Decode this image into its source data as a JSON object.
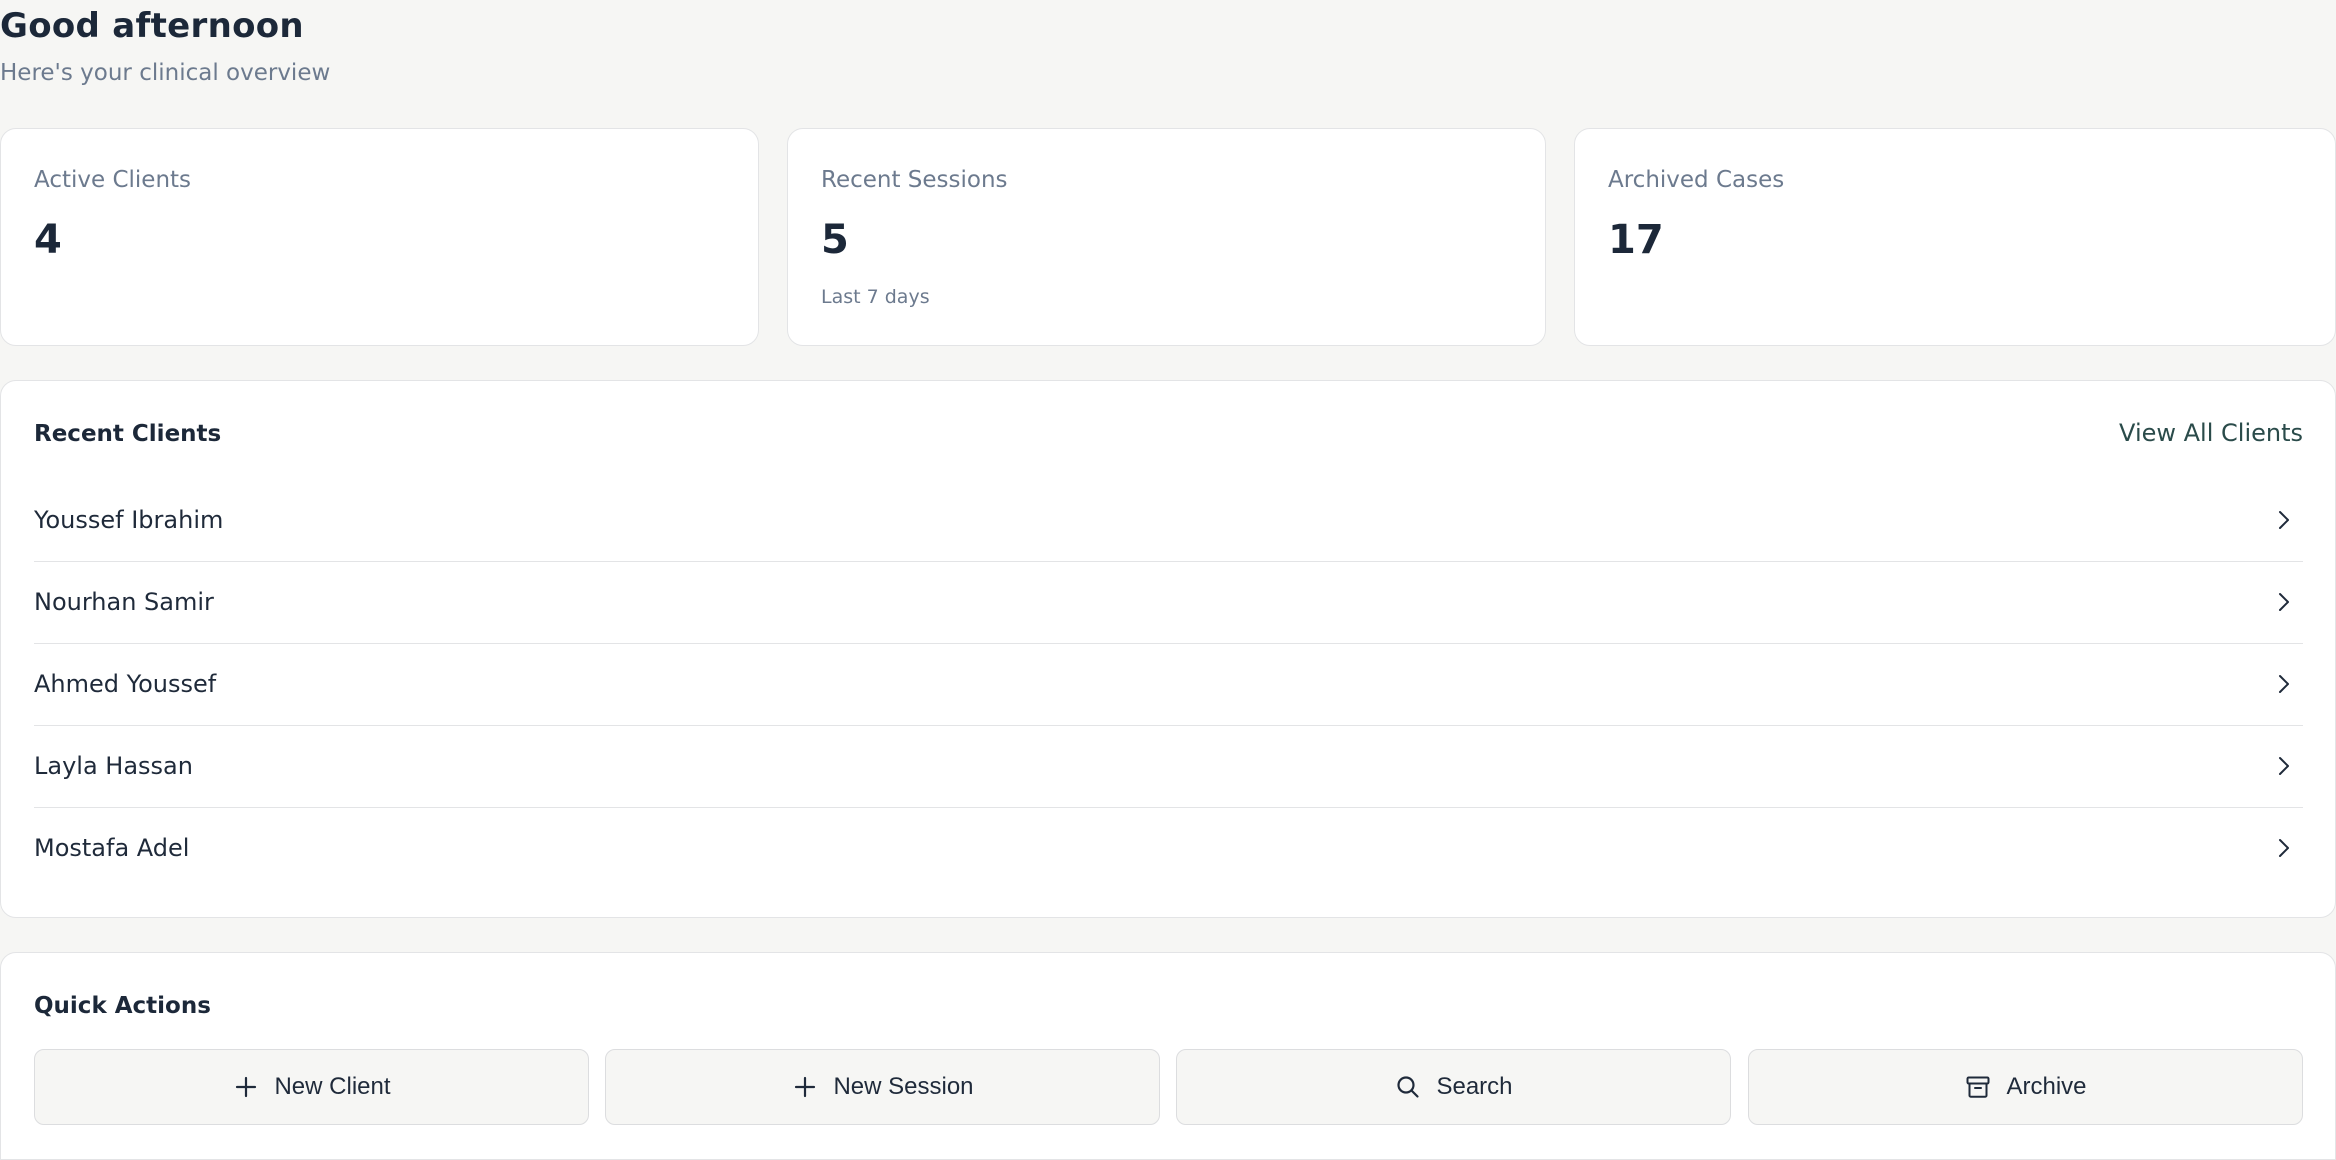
{
  "header": {
    "greeting": "Good afternoon",
    "subtitle": "Here's your clinical overview"
  },
  "stats": [
    {
      "label": "Active Clients",
      "value": "4",
      "note": ""
    },
    {
      "label": "Recent Sessions",
      "value": "5",
      "note": "Last 7 days"
    },
    {
      "label": "Archived Cases",
      "value": "17",
      "note": ""
    }
  ],
  "recent_clients": {
    "title": "Recent Clients",
    "view_all_label": "View All Clients",
    "items": [
      {
        "name": "Youssef Ibrahim"
      },
      {
        "name": "Nourhan Samir"
      },
      {
        "name": "Ahmed Youssef"
      },
      {
        "name": "Layla Hassan"
      },
      {
        "name": "Mostafa Adel"
      }
    ]
  },
  "quick_actions": {
    "title": "Quick Actions",
    "buttons": [
      {
        "label": "New Client",
        "icon": "plus-icon"
      },
      {
        "label": "New Session",
        "icon": "plus-icon"
      },
      {
        "label": "Search",
        "icon": "search-icon"
      },
      {
        "label": "Archive",
        "icon": "archive-icon"
      }
    ]
  },
  "colors": {
    "background": "#f6f6f4",
    "card": "#ffffff",
    "text_primary": "#1c2839",
    "text_muted": "#6c7a8e",
    "link": "#2a4b4a",
    "border": "#e3e4e6"
  }
}
